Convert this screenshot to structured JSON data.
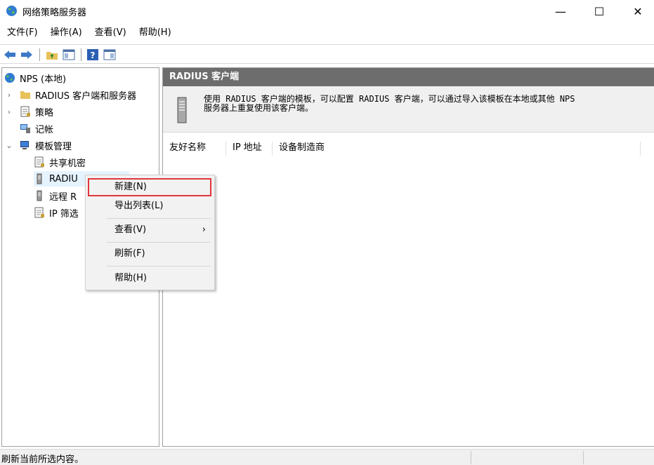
{
  "window": {
    "title": "网络策略服务器",
    "minimize": "—",
    "maximize": "☐",
    "close": "✕"
  },
  "menu": [
    "文件(F)",
    "操作(A)",
    "查看(V)",
    "帮助(H)"
  ],
  "tree": {
    "root": "NPS (本地)",
    "radius_clients_servers": "RADIUS 客户端和服务器",
    "policies": "策略",
    "accounting": "记帐",
    "templates": "模板管理",
    "shared_secrets": "共享机密",
    "radius_clients": "RADIU",
    "remote_radius": "远程 R",
    "ip_filters": "IP 筛选"
  },
  "right_pane": {
    "header": "RADIUS 客户端",
    "info_line1": "使用 RADIUS 客户端的模板，可以配置 RADIUS 客户端，可以通过导入该模板在本地或其他 NPS",
    "info_line2": "服务器上重复使用该客户端。",
    "columns": [
      "友好名称",
      "IP 地址",
      "设备制造商"
    ]
  },
  "context_menu": {
    "new": "新建(N)",
    "export": "导出列表(L)",
    "view": "查看(V)",
    "view_arrow": "›",
    "refresh": "刷新(F)",
    "help": "帮助(H)"
  },
  "status": {
    "text": "刷新当前所选内容。"
  },
  "colors": {
    "header_bg": "#6d6d6d",
    "highlight_border": "#e0353b",
    "menu_bg": "#f2f2f2"
  }
}
